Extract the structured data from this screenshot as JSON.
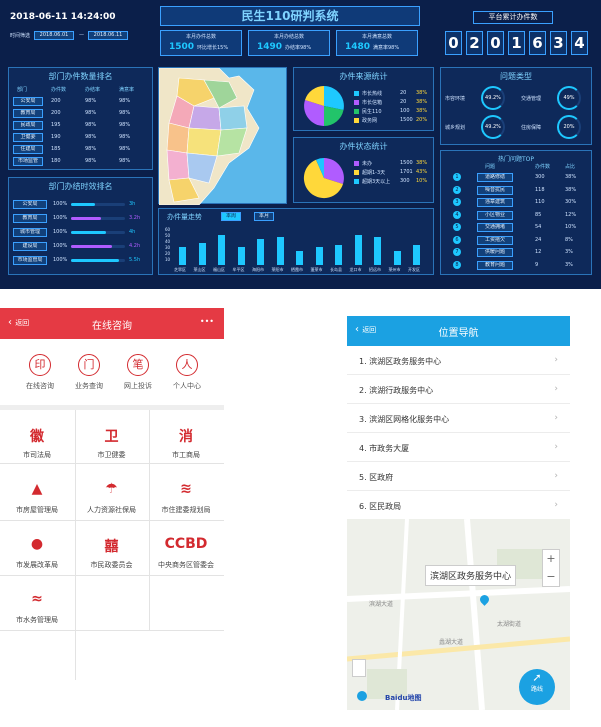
{
  "colors": {
    "dash_bg": "#0b1f4a",
    "accent_cyan": "#1ec8ff",
    "chat_red": "#e53a44",
    "nav_blue": "#1ba1e2"
  },
  "dashboard": {
    "datetime": "2018-06-11  14:24:00",
    "time_label": "时间筛选",
    "date_from": "2018.06.01",
    "date_to": "2018.06.11",
    "title": "民生110研判系统",
    "stats": [
      {
        "label": "本月办件总数",
        "value": "1500",
        "sub": "环比增长15%"
      },
      {
        "label": "本月办结总数",
        "value": "1490",
        "sub": "办结率98%"
      },
      {
        "label": "本月满意总数",
        "value": "1480",
        "sub": "满意率98%"
      }
    ],
    "counter_title": "平台累计办件数",
    "counter_digits": [
      "0",
      "2",
      "0",
      "1",
      "6",
      "3",
      "4"
    ],
    "dept_rank": {
      "title": "部门办件数量排名",
      "headers": [
        "部门",
        "办件数",
        "办结率",
        "满意率"
      ],
      "rows": [
        [
          "公安局",
          "200",
          "98%",
          "98%"
        ],
        [
          "教育局",
          "200",
          "98%",
          "98%"
        ],
        [
          "民政局",
          "195",
          "98%",
          "98%"
        ],
        [
          "卫健委",
          "190",
          "98%",
          "98%"
        ],
        [
          "住建局",
          "185",
          "98%",
          "98%"
        ],
        [
          "市场监管",
          "180",
          "98%",
          "98%"
        ]
      ]
    },
    "dept_done": {
      "title": "部门办结时效排名",
      "rows": [
        {
          "name": "公安局",
          "pct": "100%",
          "val": "3h",
          "fill": 0.45,
          "color": "#1ec8ff"
        },
        {
          "name": "教育局",
          "pct": "100%",
          "val": "3.2h",
          "fill": 0.55,
          "color": "#b05cff"
        },
        {
          "name": "城市管理",
          "pct": "100%",
          "val": "4h",
          "fill": 0.65,
          "color": "#1ec8ff"
        },
        {
          "name": "建设局",
          "pct": "100%",
          "val": "4.2h",
          "fill": 0.75,
          "color": "#b05cff"
        },
        {
          "name": "市场监管局",
          "pct": "100%",
          "val": "5.5h",
          "fill": 0.88,
          "color": "#1ec8ff"
        }
      ]
    },
    "source": {
      "title": "办件来源统计",
      "items": [
        {
          "label": "市长热线",
          "val": "20",
          "pct": "38%",
          "color": "#1ec8ff"
        },
        {
          "label": "市长信箱",
          "val": "20",
          "pct": "38%",
          "color": "#b05cff"
        },
        {
          "label": "民生110",
          "val": "100",
          "pct": "38%",
          "color": "#22c46a"
        },
        {
          "label": "政务网",
          "val": "1500",
          "pct": "20%",
          "color": "#ffd83a"
        }
      ]
    },
    "status": {
      "title": "办件状态统计",
      "items": [
        {
          "label": "未办",
          "val": "1500",
          "pct": "38%",
          "color": "#b05cff"
        },
        {
          "label": "超期1-3天",
          "val": "1701",
          "pct": "43%",
          "color": "#ffd83a"
        },
        {
          "label": "超期3天以上",
          "val": "300",
          "pct": "10%",
          "color": "#1ec8ff"
        }
      ]
    },
    "trend": {
      "title": "办件量走势",
      "tabs": [
        "本周",
        "本月"
      ],
      "ticks": [
        "60",
        "50",
        "40",
        "30",
        "20",
        "10"
      ],
      "categories": [
        "芝罘区",
        "莱山区",
        "福山区",
        "牟平区",
        "海阳市",
        "莱阳市",
        "栖霞市",
        "蓬莱市",
        "长岛县",
        "龙口市",
        "招远市",
        "莱州市",
        "开发区"
      ]
    },
    "problem": {
      "title": "问题类型",
      "gauges": [
        {
          "label": "市容环境",
          "val": "49.2%"
        },
        {
          "label": "交通管理",
          "val": "49%"
        },
        {
          "label": "城乡规划",
          "val": "49.2%"
        },
        {
          "label": "住房保障",
          "val": "20%"
        }
      ]
    },
    "top": {
      "title": "热门问题TOP",
      "headers": [
        "问题",
        "办件数",
        "占比"
      ],
      "rows": [
        {
          "rank": "1",
          "name": "道路修缮",
          "count": "300",
          "pct": "38%"
        },
        {
          "rank": "2",
          "name": "噪音扰民",
          "count": "118",
          "pct": "38%"
        },
        {
          "rank": "3",
          "name": "违章建筑",
          "count": "110",
          "pct": "30%"
        },
        {
          "rank": "4",
          "name": "小区物业",
          "count": "85",
          "pct": "12%"
        },
        {
          "rank": "5",
          "name": "交通拥堵",
          "count": "54",
          "pct": "10%"
        },
        {
          "rank": "6",
          "name": "工资拖欠",
          "count": "24",
          "pct": "8%"
        },
        {
          "rank": "7",
          "name": "供暖问题",
          "count": "12",
          "pct": "3%"
        },
        {
          "rank": "8",
          "name": "教育问题",
          "count": "9",
          "pct": "3%"
        }
      ]
    }
  },
  "chat": {
    "back": "返回",
    "title": "在线咨询",
    "more": "•••",
    "quick": [
      {
        "icon": "印",
        "label": "在线咨询"
      },
      {
        "icon": "门",
        "label": "业务查询"
      },
      {
        "icon": "笔",
        "label": "网上投诉"
      },
      {
        "icon": "人",
        "label": "个人中心"
      }
    ],
    "grid": [
      {
        "icon": "徽",
        "label": "市司法局"
      },
      {
        "icon": "卫",
        "label": "市卫健委"
      },
      {
        "icon": "消",
        "label": "市工商局"
      },
      {
        "icon": "▲",
        "label": "市房屋管理局"
      },
      {
        "icon": "☂",
        "label": "人力资源社保局"
      },
      {
        "icon": "≋",
        "label": "市住建委规划局"
      },
      {
        "icon": "●",
        "label": "市发展改革局"
      },
      {
        "icon": "囍",
        "label": "市民政委员会"
      },
      {
        "icon": "CCBD",
        "label": "中央商务区管委会"
      },
      {
        "icon": "≈",
        "label": "市水务管理局"
      }
    ]
  },
  "nav": {
    "back": "返回",
    "title": "位置导航",
    "items": [
      "1. 滨湖区政务服务中心",
      "2. 滨湖行政服务中心",
      "3. 滨湖区网格化服务中心",
      "4. 市政务大厦",
      "5. 区政府",
      "6. 区民政局"
    ],
    "map_label": "滨湖区政务服务中心",
    "place_labels": [
      "滨湖大道",
      "蠡湖大道",
      "太湖街道"
    ],
    "route_label": "路线",
    "logo": "Baidu地图"
  }
}
